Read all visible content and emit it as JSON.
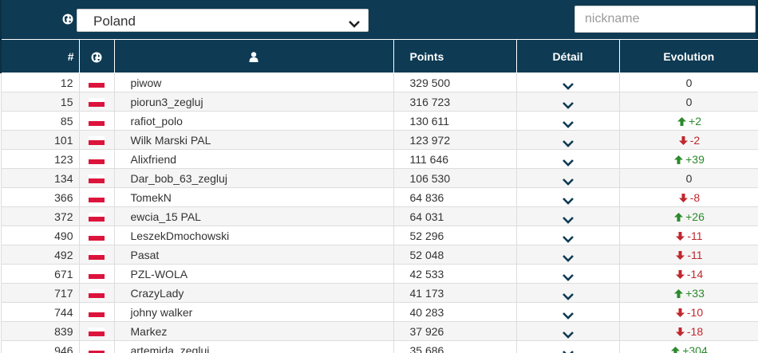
{
  "filter": {
    "country_selected": "Poland",
    "nickname_placeholder": "nickname"
  },
  "table": {
    "headers": {
      "rank": "#",
      "points": "Points",
      "detail": "Détail",
      "evolution": "Evolution"
    },
    "rows": [
      {
        "rank": "12",
        "nickname": "piwow",
        "points": "329 500",
        "evolution": "0",
        "trend": "zero"
      },
      {
        "rank": "15",
        "nickname": "piorun3_zegluj",
        "points": "316 723",
        "evolution": "0",
        "trend": "zero"
      },
      {
        "rank": "85",
        "nickname": "rafiot_polo",
        "points": "130 611",
        "evolution": "+2",
        "trend": "up"
      },
      {
        "rank": "101",
        "nickname": "Wilk Marski PAL",
        "points": "123 972",
        "evolution": "-2",
        "trend": "down"
      },
      {
        "rank": "123",
        "nickname": "Alixfriend",
        "points": "111 646",
        "evolution": "+39",
        "trend": "up"
      },
      {
        "rank": "134",
        "nickname": "Dar_bob_63_zegluj",
        "points": "106 530",
        "evolution": "0",
        "trend": "zero"
      },
      {
        "rank": "366",
        "nickname": "TomekN",
        "points": "64 836",
        "evolution": "-8",
        "trend": "down"
      },
      {
        "rank": "372",
        "nickname": "ewcia_15 PAL",
        "points": "64 031",
        "evolution": "+26",
        "trend": "up"
      },
      {
        "rank": "490",
        "nickname": "LeszekDmochowski",
        "points": "52 296",
        "evolution": "-11",
        "trend": "down"
      },
      {
        "rank": "492",
        "nickname": "Pasat",
        "points": "52 048",
        "evolution": "-11",
        "trend": "down"
      },
      {
        "rank": "671",
        "nickname": "PZL-WOLA",
        "points": "42 533",
        "evolution": "-14",
        "trend": "down"
      },
      {
        "rank": "717",
        "nickname": "CrazyLady",
        "points": "41 173",
        "evolution": "+33",
        "trend": "up"
      },
      {
        "rank": "744",
        "nickname": "johny walker",
        "points": "40 283",
        "evolution": "-10",
        "trend": "down"
      },
      {
        "rank": "839",
        "nickname": "Markez",
        "points": "37 926",
        "evolution": "-18",
        "trend": "down"
      },
      {
        "rank": "946",
        "nickname": "artemida_zegluj",
        "points": "35 686",
        "evolution": "+304",
        "trend": "up"
      }
    ]
  },
  "icons": {
    "country": "globe-icon",
    "user": "user-icon",
    "detail": "chevron-down-icon",
    "up": "arrow-up-icon",
    "down": "arrow-down-icon",
    "flag": "poland-flag-icon"
  },
  "colors": {
    "header_bg": "#0e3a53",
    "up": "#2b8a2b",
    "down": "#c0272d",
    "flag_red": "#dc143c"
  }
}
